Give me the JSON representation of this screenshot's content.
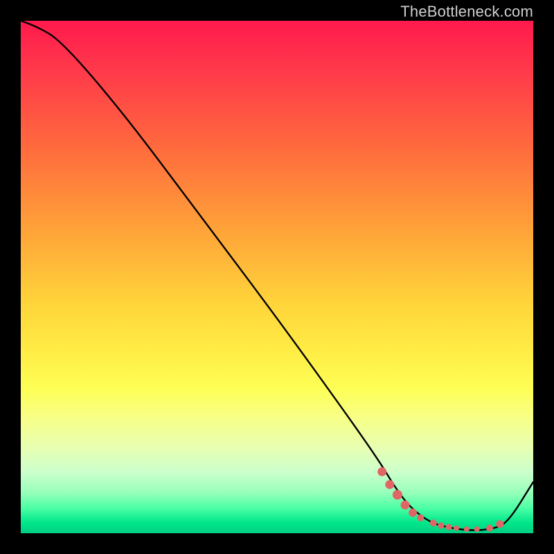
{
  "watermark": "TheBottleneck.com",
  "chart_data": {
    "type": "line",
    "title": "",
    "xlabel": "",
    "ylabel": "",
    "xlim": [
      0,
      100
    ],
    "ylim": [
      0,
      100
    ],
    "grid": false,
    "background_gradient": {
      "type": "vertical",
      "colors": [
        "#ff1a4d",
        "#ffa039",
        "#ffee46",
        "#00d084"
      ]
    },
    "series": [
      {
        "name": "bottleneck-curve",
        "color": "#000000",
        "type": "line",
        "x": [
          0,
          3,
          8,
          20,
          35,
          50,
          63,
          70,
          73,
          76,
          80,
          84,
          88,
          92,
          95,
          100
        ],
        "values": [
          100,
          99,
          96,
          82,
          62,
          42,
          24,
          14,
          9,
          5,
          2,
          1,
          0.5,
          0.8,
          2,
          10
        ]
      },
      {
        "name": "marker-dots",
        "color": "#e06666",
        "type": "scatter",
        "x": [
          70.5,
          72,
          73.5,
          75,
          76.5,
          78,
          80.5,
          82,
          83.5,
          85,
          87,
          89,
          91.5,
          93.5
        ],
        "values": [
          12,
          9.5,
          7.5,
          5.5,
          4,
          3,
          2,
          1.5,
          1.2,
          1,
          0.8,
          0.8,
          1,
          1.8
        ]
      }
    ]
  },
  "plot": {
    "curve_color": "#000000",
    "dot_color": "#e06666",
    "curve_path_norm": [
      [
        0.0,
        0.0
      ],
      [
        0.03,
        0.01
      ],
      [
        0.08,
        0.04
      ],
      [
        0.2,
        0.18
      ],
      [
        0.35,
        0.38
      ],
      [
        0.5,
        0.58
      ],
      [
        0.63,
        0.76
      ],
      [
        0.7,
        0.86
      ],
      [
        0.73,
        0.91
      ],
      [
        0.76,
        0.95
      ],
      [
        0.8,
        0.98
      ],
      [
        0.84,
        0.99
      ],
      [
        0.88,
        0.995
      ],
      [
        0.92,
        0.992
      ],
      [
        0.95,
        0.98
      ],
      [
        1.0,
        0.9
      ]
    ],
    "dots_norm": [
      [
        0.705,
        0.88,
        6.5
      ],
      [
        0.72,
        0.905,
        6.5
      ],
      [
        0.735,
        0.925,
        7.0
      ],
      [
        0.75,
        0.945,
        6.5
      ],
      [
        0.765,
        0.96,
        6.0
      ],
      [
        0.78,
        0.97,
        5.0
      ],
      [
        0.805,
        0.98,
        5.0
      ],
      [
        0.82,
        0.985,
        4.5
      ],
      [
        0.835,
        0.988,
        4.5
      ],
      [
        0.85,
        0.99,
        4.0
      ],
      [
        0.87,
        0.992,
        4.0
      ],
      [
        0.89,
        0.992,
        4.0
      ],
      [
        0.915,
        0.99,
        5.0
      ],
      [
        0.935,
        0.982,
        5.5
      ]
    ]
  }
}
